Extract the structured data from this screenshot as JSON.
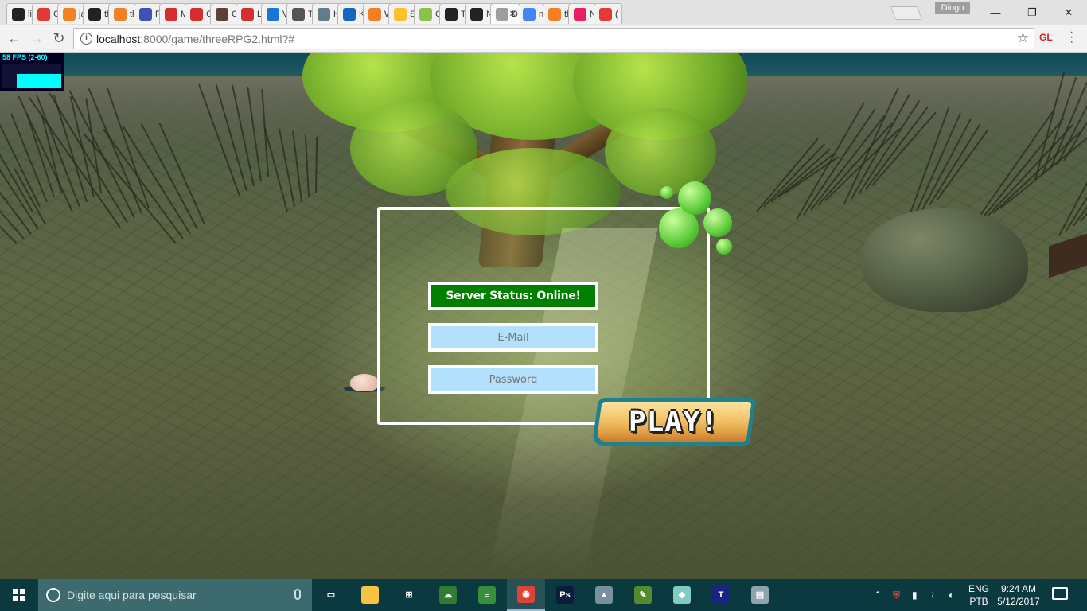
{
  "browser": {
    "tabs": [
      {
        "title": "lil",
        "icon": "github-icon",
        "color": "#222222"
      },
      {
        "title": "C",
        "icon": "oracle-icon",
        "color": "#e53935"
      },
      {
        "title": "ja",
        "icon": "stackoverflow-icon",
        "color": "#f48024"
      },
      {
        "title": "th",
        "icon": "github-icon",
        "color": "#222222"
      },
      {
        "title": "th",
        "icon": "stackoverflow-icon",
        "color": "#f48024"
      },
      {
        "title": "R",
        "icon": "m-circle-icon",
        "color": "#3f51b5"
      },
      {
        "title": "M",
        "icon": "ti-icon",
        "color": "#d32f2f"
      },
      {
        "title": "C",
        "icon": "ti-icon",
        "color": "#d32f2f"
      },
      {
        "title": "C",
        "icon": "bolt-icon",
        "color": "#5d4037"
      },
      {
        "title": "Li",
        "icon": "ti-icon",
        "color": "#d32f2f"
      },
      {
        "title": "V",
        "icon": "eye-icon",
        "color": "#1976d2"
      },
      {
        "title": "Tl",
        "icon": "wikipedia-icon",
        "color": "#555555"
      },
      {
        "title": "H",
        "icon": "diamond-icon",
        "color": "#607d8b"
      },
      {
        "title": "K",
        "icon": "m-square-icon",
        "color": "#1565c0"
      },
      {
        "title": "W",
        "icon": "stackoverflow-icon",
        "color": "#f48024"
      },
      {
        "title": "S",
        "icon": "smiley-icon",
        "color": "#fbc02d"
      },
      {
        "title": "C",
        "icon": "cloud-icon",
        "color": "#8bc34a"
      },
      {
        "title": "T",
        "icon": "github-icon",
        "color": "#222222"
      },
      {
        "title": "N",
        "icon": "github-icon",
        "color": "#222222"
      },
      {
        "title": "D",
        "icon": "page-icon",
        "color": "#9e9e9e",
        "active": true
      },
      {
        "title": "n",
        "icon": "google-icon",
        "color": "#4285f4"
      },
      {
        "title": "th",
        "icon": "stackoverflow-icon",
        "color": "#f48024"
      },
      {
        "title": "N",
        "icon": "triangle-icon",
        "color": "#e91e63"
      },
      {
        "title": "(",
        "icon": "youtube-icon",
        "color": "#e53935"
      }
    ],
    "profile_name": "Diogo",
    "url_host": "localhost",
    "url_rest": ":8000/game/threeRPG2.html?#",
    "ext_label": "GL"
  },
  "game": {
    "fps_label": "58 FPS (2-60)",
    "server_status": "Server Status: Online!",
    "email_placeholder": "E-Mail",
    "password_placeholder": "Password",
    "play_label": "PLAY!",
    "colors": {
      "status_bg": "#017f01",
      "input_bg": "#b2e0fd",
      "play_border": "#20808c"
    }
  },
  "taskbar": {
    "search_placeholder": "Digite aqui para pesquisar",
    "apps": [
      {
        "name": "task-view-icon",
        "color": "#0a3a3f",
        "glyph": "▭"
      },
      {
        "name": "file-explorer-icon",
        "color": "#f6c343",
        "glyph": ""
      },
      {
        "name": "store-icon",
        "color": "#0a3a3f",
        "glyph": "⊞"
      },
      {
        "name": "cloud-app-icon",
        "color": "#2e7d32",
        "glyph": "☁"
      },
      {
        "name": "notes-icon",
        "color": "#388e3c",
        "glyph": "≡"
      },
      {
        "name": "chrome-icon",
        "color": "#db4437",
        "glyph": "◉"
      },
      {
        "name": "photoshop-icon",
        "color": "#0b1d3a",
        "glyph": "Ps"
      },
      {
        "name": "chart-app-icon",
        "color": "#78909c",
        "glyph": "▲"
      },
      {
        "name": "edit-app-icon",
        "color": "#558b2f",
        "glyph": "✎"
      },
      {
        "name": "crystal-app-icon",
        "color": "#80cbc4",
        "glyph": "◆"
      },
      {
        "name": "tetris-app-icon",
        "color": "#1a237e",
        "glyph": "T"
      },
      {
        "name": "window-app-icon",
        "color": "#90a4ae",
        "glyph": "▤"
      }
    ],
    "lang_top": "ENG",
    "lang_bottom": "PTB",
    "time": "9:24 AM",
    "date": "5/12/2017"
  }
}
